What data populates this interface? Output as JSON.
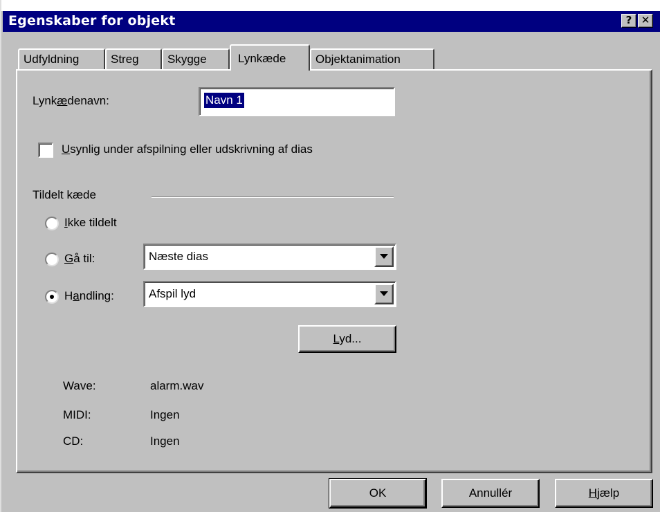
{
  "window": {
    "title": "Egenskaber for objekt",
    "help_glyph": "?",
    "close_glyph": "✕"
  },
  "tabs": [
    {
      "label": "Udfyldning",
      "active": false
    },
    {
      "label": "Streg",
      "active": false
    },
    {
      "label": "Skygge",
      "active": false
    },
    {
      "label": "Lynkæde",
      "active": true
    },
    {
      "label": "Objektanimation",
      "active": false
    }
  ],
  "form": {
    "chain_name_label_pre": "Lynk",
    "chain_name_label_acc": "æ",
    "chain_name_label_post": "denavn:",
    "chain_name_value": "Navn 1",
    "invisible_checkbox_acc": "U",
    "invisible_checkbox_rest": "synlig under afspilning eller udskrivning af dias",
    "invisible_checked": false,
    "group_label": "Tildelt kæde",
    "radio_none_acc": "I",
    "radio_none_rest": "kke tildelt",
    "radio_goto_acc": "G",
    "radio_goto_rest": "å til:",
    "radio_action_pre": "H",
    "radio_action_acc": "a",
    "radio_action_rest": "ndling:",
    "selected_radio": "action",
    "goto_value": "Næste dias",
    "action_value": "Afspil lyd",
    "sound_button_acc": "L",
    "sound_button_rest": "yd..."
  },
  "sound_info": {
    "wave_label": "Wave:",
    "wave_value": "alarm.wav",
    "midi_label": "MIDI:",
    "midi_value": "Ingen",
    "cd_label": "CD:",
    "cd_value": "Ingen"
  },
  "buttons": {
    "ok": "OK",
    "cancel": "Annullér",
    "help_acc": "H",
    "help_rest": "jælp"
  }
}
